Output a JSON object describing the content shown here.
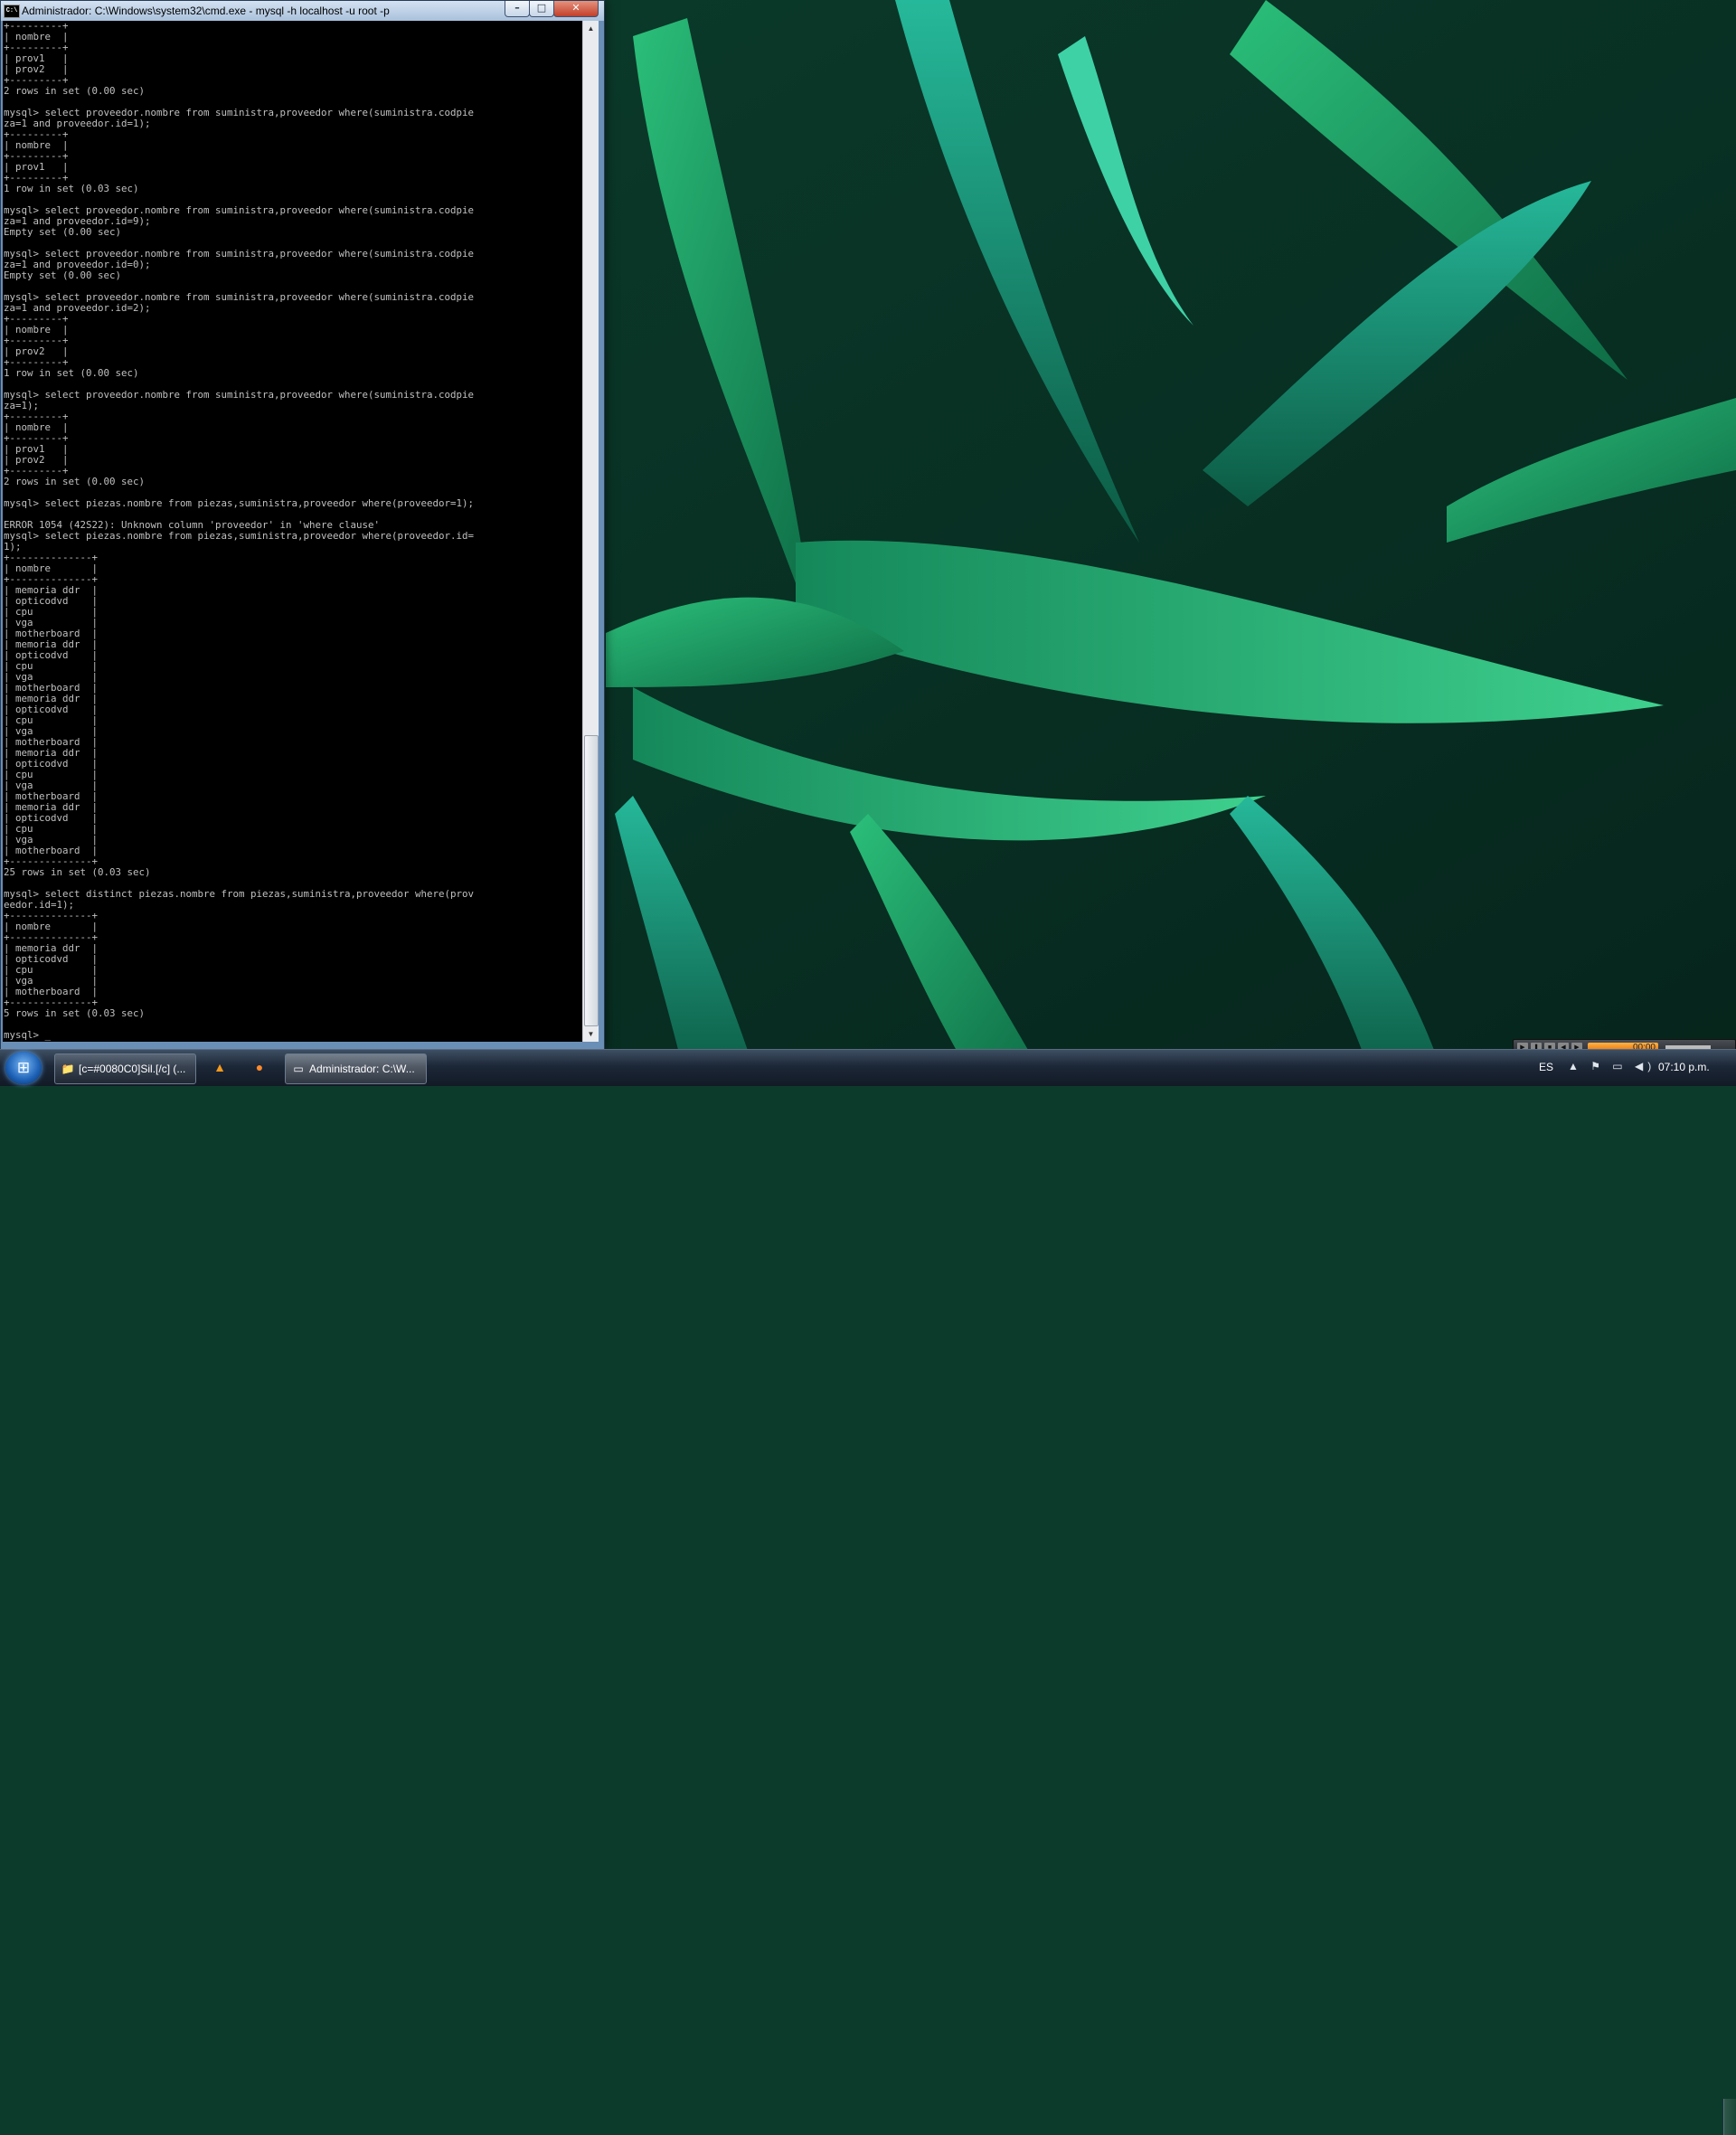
{
  "window": {
    "title": "Administrador: C:\\Windows\\system32\\cmd.exe - mysql  -h localhost -u root -p",
    "icon": "C:\\",
    "controls": {
      "minimize": "–",
      "maximize": "□",
      "close": "✕"
    }
  },
  "console": {
    "lines": [
      "+---------+",
      "| nombre  |",
      "+---------+",
      "| prov1   |",
      "| prov2   |",
      "+---------+",
      "2 rows in set (0.00 sec)",
      "",
      "mysql> select proveedor.nombre from suministra,proveedor where(suministra.codpie",
      "za=1 and proveedor.id=1);",
      "+---------+",
      "| nombre  |",
      "+---------+",
      "| prov1   |",
      "+---------+",
      "1 row in set (0.03 sec)",
      "",
      "mysql> select proveedor.nombre from suministra,proveedor where(suministra.codpie",
      "za=1 and proveedor.id=9);",
      "Empty set (0.00 sec)",
      "",
      "mysql> select proveedor.nombre from suministra,proveedor where(suministra.codpie",
      "za=1 and proveedor.id=0);",
      "Empty set (0.00 sec)",
      "",
      "mysql> select proveedor.nombre from suministra,proveedor where(suministra.codpie",
      "za=1 and proveedor.id=2);",
      "+---------+",
      "| nombre  |",
      "+---------+",
      "| prov2   |",
      "+---------+",
      "1 row in set (0.00 sec)",
      "",
      "mysql> select proveedor.nombre from suministra,proveedor where(suministra.codpie",
      "za=1);",
      "+---------+",
      "| nombre  |",
      "+---------+",
      "| prov1   |",
      "| prov2   |",
      "+---------+",
      "2 rows in set (0.00 sec)",
      "",
      "mysql> select piezas.nombre from piezas,suministra,proveedor where(proveedor=1);",
      "",
      "ERROR 1054 (42S22): Unknown column 'proveedor' in 'where clause'",
      "mysql> select piezas.nombre from piezas,suministra,proveedor where(proveedor.id=",
      "1);",
      "+--------------+",
      "| nombre       |",
      "+--------------+",
      "| memoria ddr  |",
      "| opticodvd    |",
      "| cpu          |",
      "| vga          |",
      "| motherboard  |",
      "| memoria ddr  |",
      "| opticodvd    |",
      "| cpu          |",
      "| vga          |",
      "| motherboard  |",
      "| memoria ddr  |",
      "| opticodvd    |",
      "| cpu          |",
      "| vga          |",
      "| motherboard  |",
      "| memoria ddr  |",
      "| opticodvd    |",
      "| cpu          |",
      "| vga          |",
      "| motherboard  |",
      "| memoria ddr  |",
      "| opticodvd    |",
      "| cpu          |",
      "| vga          |",
      "| motherboard  |",
      "+--------------+",
      "25 rows in set (0.03 sec)",
      "",
      "mysql> select distinct piezas.nombre from piezas,suministra,proveedor where(prov",
      "eedor.id=1);",
      "+--------------+",
      "| nombre       |",
      "+--------------+",
      "| memoria ddr  |",
      "| opticodvd    |",
      "| cpu          |",
      "| vga          |",
      "| motherboard  |",
      "+--------------+",
      "5 rows in set (0.03 sec)",
      "",
      "mysql> _"
    ]
  },
  "taskbar": {
    "start": "⊞",
    "tasks": [
      {
        "label": "[c=#0080C0]Sil.[/c] (...",
        "icon": "folder-icon"
      },
      {
        "label": "Administrador: C:\\W...",
        "icon": "cmd-icon"
      }
    ],
    "quick_launch": [
      "vlc-icon",
      "firefox-icon"
    ],
    "tray": {
      "language": "ES",
      "icons": "▲ ⚑ ▭ ◀)",
      "clock": "07:10 p.m."
    }
  },
  "media_player": {
    "time": "00:00"
  },
  "colors": {
    "console_bg": "#000000",
    "console_text": "#c0c0c0",
    "titlebar": "#bcd0e8",
    "taskbar": "#1c2737",
    "wallpaper_leaf": "#1fa36a"
  }
}
